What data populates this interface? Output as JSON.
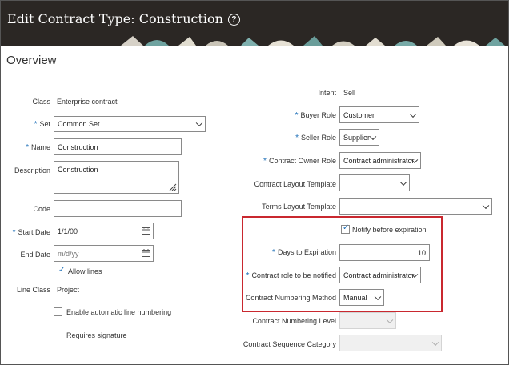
{
  "header": {
    "title": "Edit Contract Type: Construction",
    "help_icon": "?"
  },
  "section_title": "Overview",
  "left": {
    "class_label": "Class",
    "class_value": "Enterprise contract",
    "set_label": "Set",
    "set_value": "Common Set",
    "name_label": "Name",
    "name_value": "Construction",
    "description_label": "Description",
    "description_value": "Construction",
    "code_label": "Code",
    "code_value": "",
    "start_date_label": "Start Date",
    "start_date_value": "1/1/00",
    "end_date_label": "End Date",
    "end_date_placeholder": "m/d/yy",
    "allow_lines_label": "Allow lines",
    "line_class_label": "Line Class",
    "line_class_value": "Project",
    "auto_numbering_label": "Enable automatic line numbering",
    "requires_signature_label": "Requires signature"
  },
  "right": {
    "intent_label": "Intent",
    "intent_value": "Sell",
    "buyer_role_label": "Buyer Role",
    "buyer_role_value": "Customer",
    "seller_role_label": "Seller Role",
    "seller_role_value": "Supplier",
    "owner_role_label": "Contract Owner Role",
    "owner_role_value": "Contract administrator",
    "layout_template_label": "Contract Layout Template",
    "layout_template_value": "",
    "terms_template_label": "Terms Layout Template",
    "terms_template_value": "",
    "notify_label": "Notify before expiration",
    "days_label": "Days to Expiration",
    "days_value": "10",
    "notify_role_label": "Contract role to be notified",
    "notify_role_value": "Contract administrator",
    "numbering_method_label": "Contract Numbering Method",
    "numbering_method_value": "Manual",
    "numbering_level_label": "Contract Numbering Level",
    "numbering_level_value": "",
    "sequence_category_label": "Contract Sequence Category",
    "sequence_category_value": ""
  },
  "colors": {
    "header_bg": "#2b2724",
    "required_star": "#1d6fb8",
    "highlight": "#c9282f"
  }
}
